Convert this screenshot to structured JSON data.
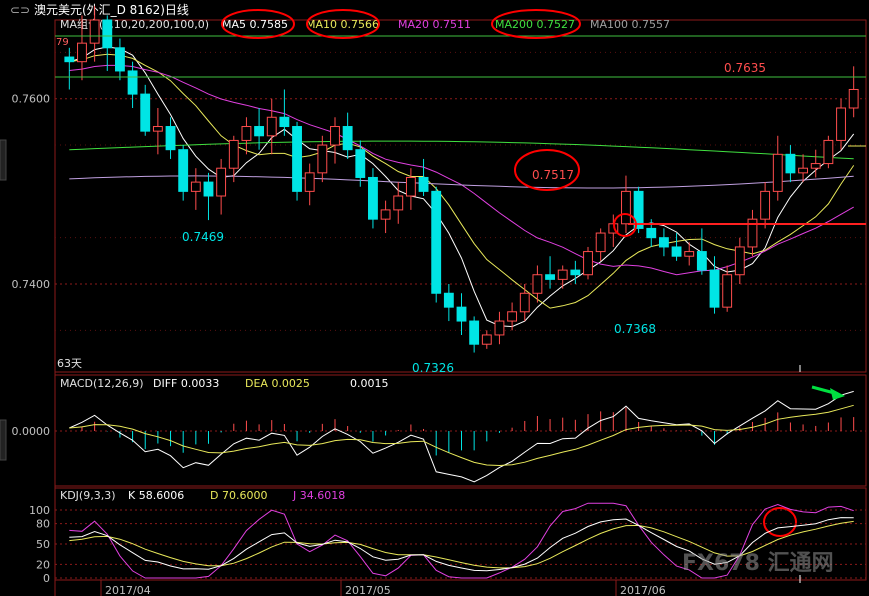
{
  "window": {
    "title_icon": "link-icon",
    "title": "澳元美元(外汇_D 8162)日线"
  },
  "colors": {
    "background": "#000000",
    "candle_up": "#ff4d4d",
    "candle_down": "#00e5e5",
    "ma5": "#ffffff",
    "ma10": "#e8e85a",
    "ma20": "#e040e0",
    "ma200": "#40e040",
    "ma100": "#a0a0a0",
    "grid": "#8b1a1a",
    "axis_text": "#c0c0c0",
    "annotation": "#ff0000",
    "arrow": "#00e040"
  },
  "price_panel": {
    "ma_legend": {
      "label": "MA组合(5,10,20,200,100,0)",
      "items": [
        {
          "name": "MA5",
          "value": "0.7585"
        },
        {
          "name": "MA10",
          "value": "0.7566"
        },
        {
          "name": "MA20",
          "value": "0.7511"
        },
        {
          "name": "MA200",
          "value": "0.7527"
        },
        {
          "name": "MA100",
          "value": "0.7557"
        }
      ]
    },
    "top_left_label": "79",
    "bars_label": "63天",
    "price_labels": [
      {
        "text": "0.7469",
        "color": "#00e5e5"
      },
      {
        "text": "0.7326",
        "color": "#00e5e5"
      },
      {
        "text": "0.7517",
        "color": "#ff4d4d"
      },
      {
        "text": "0.7368",
        "color": "#00e5e5"
      },
      {
        "text": "0.7635",
        "color": "#ff4d4d"
      }
    ]
  },
  "macd_panel": {
    "legend": {
      "label": "MACD(12,26,9)",
      "diff_label": "DIFF",
      "diff": "0.0033",
      "dea_label": "DEA",
      "dea": "0.0025",
      "macd": "0.0015"
    }
  },
  "kdj_panel": {
    "legend": {
      "label": "KDJ(9,3,3)",
      "k_label": "K",
      "k": "58.6006",
      "d_label": "D",
      "d": "70.6000",
      "j_label": "J",
      "j": "34.6018"
    }
  },
  "watermark": "FX678 汇通网",
  "chart_data": [
    {
      "type": "candlestick",
      "title": "澳元美元(外汇_D 8162)日线",
      "x": [
        "2017/04",
        "2017/05",
        "2017/06"
      ],
      "yticks": [
        0.74,
        0.76
      ],
      "ylim": [
        0.7305,
        0.7685
      ],
      "grid": true,
      "series": [
        {
          "name": "K",
          "type": "candle",
          "ohlc": [
            [
              0.7645,
              0.7655,
              0.761,
              0.764
            ],
            [
              0.764,
              0.769,
              0.762,
              0.766
            ],
            [
              0.766,
              0.77,
              0.764,
              0.7685
            ],
            [
              0.7685,
              0.769,
              0.763,
              0.7655
            ],
            [
              0.7655,
              0.7665,
              0.762,
              0.763
            ],
            [
              0.763,
              0.764,
              0.759,
              0.7605
            ],
            [
              0.7605,
              0.7615,
              0.756,
              0.7565
            ],
            [
              0.7565,
              0.759,
              0.754,
              0.757
            ],
            [
              0.757,
              0.758,
              0.7535,
              0.7545
            ],
            [
              0.7545,
              0.755,
              0.749,
              0.75
            ],
            [
              0.75,
              0.7525,
              0.748,
              0.751
            ],
            [
              0.751,
              0.752,
              0.7469,
              0.7495
            ],
            [
              0.7495,
              0.7535,
              0.7475,
              0.7525
            ],
            [
              0.7525,
              0.756,
              0.751,
              0.7555
            ],
            [
              0.7555,
              0.758,
              0.754,
              0.757
            ],
            [
              0.757,
              0.759,
              0.7545,
              0.756
            ],
            [
              0.756,
              0.76,
              0.754,
              0.758
            ],
            [
              0.758,
              0.761,
              0.756,
              0.757
            ],
            [
              0.757,
              0.7575,
              0.749,
              0.75
            ],
            [
              0.75,
              0.753,
              0.7485,
              0.752
            ],
            [
              0.752,
              0.756,
              0.751,
              0.755
            ],
            [
              0.755,
              0.758,
              0.753,
              0.757
            ],
            [
              0.757,
              0.7585,
              0.7535,
              0.7545
            ],
            [
              0.7545,
              0.7555,
              0.7505,
              0.7515
            ],
            [
              0.7515,
              0.7525,
              0.746,
              0.747
            ],
            [
              0.747,
              0.749,
              0.7455,
              0.748
            ],
            [
              0.748,
              0.751,
              0.7465,
              0.7495
            ],
            [
              0.7495,
              0.7525,
              0.748,
              0.7515
            ],
            [
              0.7515,
              0.7535,
              0.7495,
              0.75
            ],
            [
              0.75,
              0.7505,
              0.738,
              0.739
            ],
            [
              0.739,
              0.74,
              0.736,
              0.7375
            ],
            [
              0.7375,
              0.739,
              0.7345,
              0.736
            ],
            [
              0.736,
              0.7365,
              0.7326,
              0.7335
            ],
            [
              0.7335,
              0.735,
              0.733,
              0.7345
            ],
            [
              0.7345,
              0.737,
              0.7335,
              0.736
            ],
            [
              0.736,
              0.738,
              0.735,
              0.737
            ],
            [
              0.737,
              0.74,
              0.736,
              0.739
            ],
            [
              0.739,
              0.742,
              0.738,
              0.741
            ],
            [
              0.741,
              0.743,
              0.7395,
              0.7405
            ],
            [
              0.7405,
              0.742,
              0.7395,
              0.7415
            ],
            [
              0.7415,
              0.7425,
              0.74,
              0.741
            ],
            [
              0.741,
              0.744,
              0.7405,
              0.7435
            ],
            [
              0.7435,
              0.746,
              0.7425,
              0.7455
            ],
            [
              0.7455,
              0.7475,
              0.744,
              0.7465
            ],
            [
              0.7465,
              0.7517,
              0.7455,
              0.75
            ],
            [
              0.75,
              0.7505,
              0.7455,
              0.746
            ],
            [
              0.746,
              0.747,
              0.744,
              0.745
            ],
            [
              0.745,
              0.746,
              0.743,
              0.744
            ],
            [
              0.744,
              0.7455,
              0.7425,
              0.743
            ],
            [
              0.743,
              0.7445,
              0.742,
              0.7435
            ],
            [
              0.7435,
              0.746,
              0.741,
              0.7415
            ],
            [
              0.7415,
              0.743,
              0.7368,
              0.7375
            ],
            [
              0.7375,
              0.742,
              0.737,
              0.741
            ],
            [
              0.741,
              0.745,
              0.74,
              0.744
            ],
            [
              0.744,
              0.748,
              0.743,
              0.747
            ],
            [
              0.747,
              0.751,
              0.746,
              0.75
            ],
            [
              0.75,
              0.756,
              0.749,
              0.754
            ],
            [
              0.754,
              0.755,
              0.751,
              0.752
            ],
            [
              0.752,
              0.754,
              0.751,
              0.7525
            ],
            [
              0.7525,
              0.7545,
              0.7515,
              0.753
            ],
            [
              0.753,
              0.756,
              0.7525,
              0.7555
            ],
            [
              0.7555,
              0.76,
              0.7545,
              0.759
            ],
            [
              0.759,
              0.7635,
              0.758,
              0.761
            ]
          ]
        },
        {
          "name": "MA5",
          "color": "#ffffff"
        },
        {
          "name": "MA10",
          "color": "#e8e85a"
        },
        {
          "name": "MA20",
          "color": "#e040e0"
        },
        {
          "name": "MA200",
          "color": "#40e040"
        },
        {
          "name": "MA100",
          "color": "#a0a0a0"
        }
      ]
    },
    {
      "type": "bar",
      "title": "MACD(12,26,9)",
      "yticks": [
        0.0
      ],
      "series": [
        {
          "name": "DIFF",
          "color": "#ffffff"
        },
        {
          "name": "DEA",
          "color": "#e8e85a"
        },
        {
          "name": "MACD",
          "color": "#00e5e5"
        }
      ]
    },
    {
      "type": "line",
      "title": "KDJ(9,3,3)",
      "yticks": [
        0,
        20,
        50,
        80,
        100
      ],
      "series": [
        {
          "name": "K",
          "color": "#ffffff"
        },
        {
          "name": "D",
          "color": "#e8e85a"
        },
        {
          "name": "J",
          "color": "#e040e0"
        }
      ]
    }
  ]
}
